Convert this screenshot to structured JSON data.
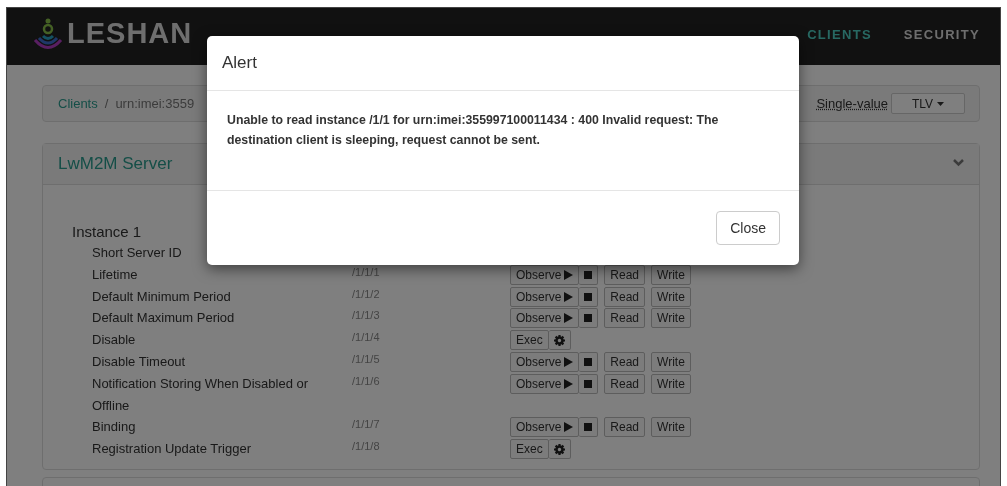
{
  "navbar": {
    "brand": "LESHAN",
    "links": [
      {
        "label": "CLIENTS",
        "selected": true
      },
      {
        "label": "SECURITY",
        "selected": false
      }
    ]
  },
  "breadcrumb": {
    "items": [
      "Clients",
      "urn:imei:3559"
    ],
    "separator": "/",
    "single_value_link": "Single-value",
    "format_dropdown": "TLV"
  },
  "panel": {
    "title": "LwM2M Server",
    "expanded": true,
    "instance": "Instance 1",
    "resources": [
      {
        "name": "Short Server ID",
        "kind": "hidden"
      },
      {
        "name": "Lifetime",
        "path": "/1/1/1",
        "kind": "rw",
        "buttons": {
          "observe": "Observe",
          "read": "Read",
          "write": "Write"
        }
      },
      {
        "name": "Default Minimum Period",
        "path": "/1/1/2",
        "kind": "rw",
        "buttons": {
          "observe": "Observe",
          "read": "Read",
          "write": "Write"
        }
      },
      {
        "name": "Default Maximum Period",
        "path": "/1/1/3",
        "kind": "rw",
        "buttons": {
          "observe": "Observe",
          "read": "Read",
          "write": "Write"
        }
      },
      {
        "name": "Disable",
        "path": "/1/1/4",
        "kind": "exec",
        "buttons": {
          "exec": "Exec"
        }
      },
      {
        "name": "Disable Timeout",
        "path": "/1/1/5",
        "kind": "rw",
        "buttons": {
          "observe": "Observe",
          "read": "Read",
          "write": "Write"
        }
      },
      {
        "name": "Notification Storing When Disabled or Offline",
        "path": "/1/1/6",
        "kind": "rw",
        "buttons": {
          "observe": "Observe",
          "read": "Read",
          "write": "Write"
        }
      },
      {
        "name": "Binding",
        "path": "/1/1/7",
        "kind": "rw",
        "buttons": {
          "observe": "Observe",
          "read": "Read",
          "write": "Write"
        }
      },
      {
        "name": "Registration Update Trigger",
        "path": "/1/1/8",
        "kind": "exec",
        "buttons": {
          "exec": "Exec"
        }
      }
    ]
  },
  "modal": {
    "title": "Alert",
    "message": "Unable to read instance /1/1 for urn:imei:355997100011434 : 400 Invalid request: The destination client is sleeping, request cannot be sent.",
    "close": "Close"
  }
}
